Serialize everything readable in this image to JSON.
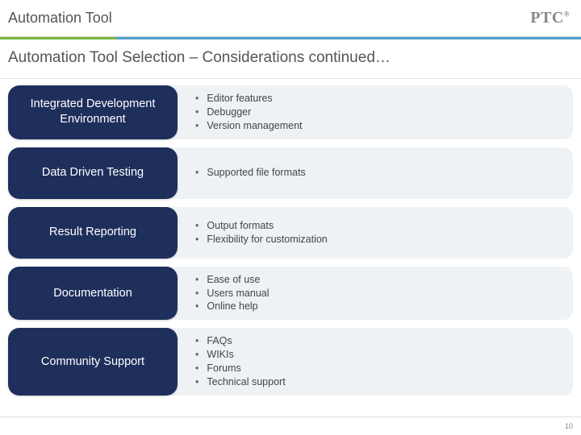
{
  "header": {
    "title": "Automation Tool",
    "logo": "PTC",
    "logo_reg": "®"
  },
  "subtitle": "Automation Tool Selection – Considerations continued…",
  "rows": [
    {
      "label": "Integrated Development Environment",
      "bullets": [
        "Editor features",
        "Debugger",
        "Version management"
      ]
    },
    {
      "label": "Data Driven Testing",
      "bullets": [
        "Supported file formats"
      ]
    },
    {
      "label": "Result Reporting",
      "bullets": [
        "Output formats",
        "Flexibility for customization"
      ]
    },
    {
      "label": "Documentation",
      "bullets": [
        "Ease of use",
        "Users manual",
        "Online help"
      ]
    },
    {
      "label": "Community Support",
      "bullets": [
        "FAQs",
        "WIKIs",
        "Forums",
        "Technical support"
      ]
    }
  ],
  "page_number": "10"
}
